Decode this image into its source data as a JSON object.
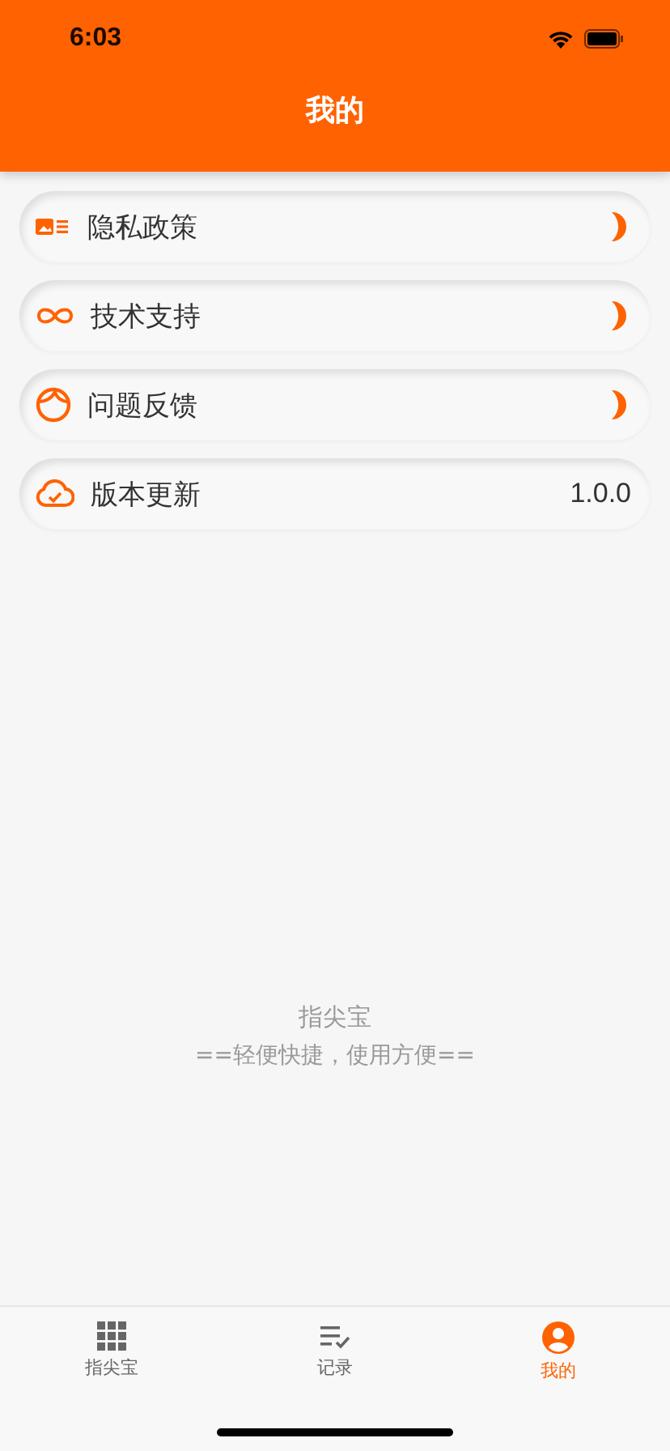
{
  "status_bar": {
    "time": "6:03"
  },
  "header": {
    "title": "我的"
  },
  "menu": [
    {
      "label": "隐私政策",
      "kind": "link"
    },
    {
      "label": "技术支持",
      "kind": "link"
    },
    {
      "label": "问题反馈",
      "kind": "link"
    },
    {
      "label": "版本更新",
      "kind": "value",
      "value": "1.0.0"
    }
  ],
  "footer": {
    "app_name": "指尖宝",
    "slogan": "==轻便快捷，使用方便=="
  },
  "tab_bar": [
    {
      "label": "指尖宝",
      "selected": false
    },
    {
      "label": "记录",
      "selected": false
    },
    {
      "label": "我的",
      "selected": true
    }
  ]
}
